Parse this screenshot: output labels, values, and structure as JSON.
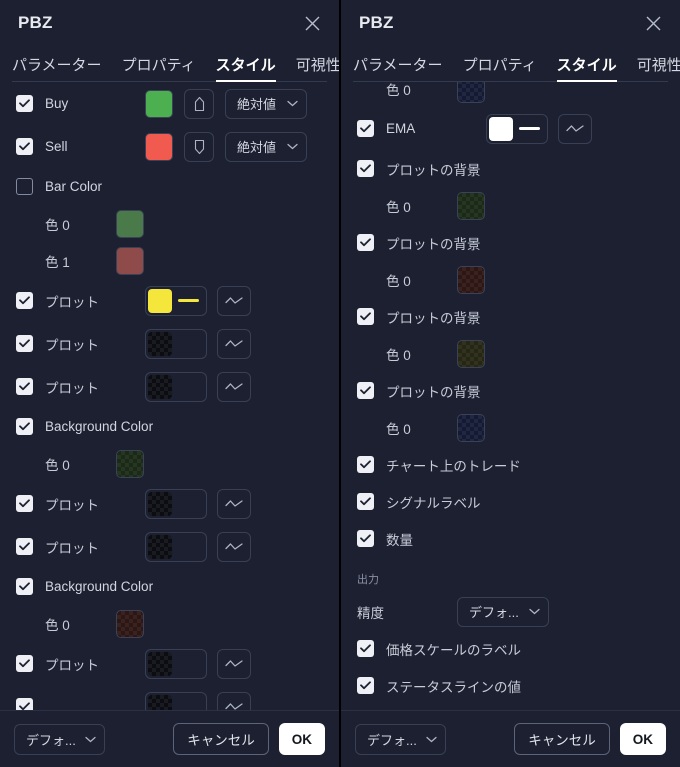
{
  "window": {
    "title": "PBZ",
    "close_icon": "close-icon"
  },
  "tabs": [
    {
      "label": "パラメーター",
      "active": false
    },
    {
      "label": "プロパティ",
      "active": false
    },
    {
      "label": "スタイル",
      "active": true
    },
    {
      "label": "可視性",
      "active": false
    }
  ],
  "footer": {
    "defaults_label": "デフォ...",
    "cancel_label": "キャンセル",
    "ok_label": "OK",
    "chevron_icon": "chevron-down-icon"
  },
  "colors": {
    "panel_bg": "#1c2030",
    "buy_green": "#4caf50",
    "sell_red": "#f05a4f",
    "bar_green": "#4a7a4a",
    "bar_red": "#8f4a4a",
    "plot_yellow": "#f5e63c",
    "ema_white": "#ffffff",
    "accent_underline": "#ffffff",
    "checker_neutral": "#0c0d12",
    "checker_green": "#1a2a16",
    "checker_red": "#2e1614",
    "checker_olive": "#262614",
    "checker_blue": "#141a33"
  },
  "left_panel": {
    "rows": [
      {
        "kind": "plot_marker",
        "checked": true,
        "label": "Buy",
        "swatch": "#4caf50",
        "marker_icon": "arrow-up-marker-icon",
        "select_value": "絶対値"
      },
      {
        "kind": "plot_marker",
        "checked": true,
        "label": "Sell",
        "swatch": "#f05a4f",
        "marker_icon": "arrow-down-marker-icon",
        "select_value": "絶対値"
      },
      {
        "kind": "header",
        "checked": false,
        "label": "Bar Color"
      },
      {
        "kind": "sub_color",
        "label": "色 0",
        "swatch": "#4a7a4a",
        "transparent": false
      },
      {
        "kind": "sub_color",
        "label": "色 1",
        "swatch": "#8f4a4a",
        "transparent": false
      },
      {
        "kind": "plot_line",
        "checked": true,
        "label": "プロット",
        "swatch": "#f5e63c",
        "line_color": "#f5e63c",
        "transparent": false,
        "style_icon": "line-style-icon"
      },
      {
        "kind": "plot_line",
        "checked": true,
        "label": "プロット",
        "swatch": "transparent",
        "line_color": "transparent",
        "transparent": true,
        "style_icon": "line-style-icon"
      },
      {
        "kind": "plot_line",
        "checked": true,
        "label": "プロット",
        "swatch": "transparent",
        "line_color": "transparent",
        "transparent": true,
        "style_icon": "line-style-icon"
      },
      {
        "kind": "header",
        "checked": true,
        "label": "Background Color"
      },
      {
        "kind": "sub_color",
        "label": "色 0",
        "swatch": "#1a2a16",
        "transparent": true
      },
      {
        "kind": "plot_line",
        "checked": true,
        "label": "プロット",
        "swatch": "transparent",
        "line_color": "transparent",
        "transparent": true,
        "style_icon": "line-style-icon"
      },
      {
        "kind": "plot_line",
        "checked": true,
        "label": "プロット",
        "swatch": "transparent",
        "line_color": "transparent",
        "transparent": true,
        "style_icon": "line-style-icon"
      },
      {
        "kind": "header",
        "checked": true,
        "label": "Background Color"
      },
      {
        "kind": "sub_color",
        "label": "色 0",
        "swatch": "#2e1614",
        "transparent": true
      },
      {
        "kind": "plot_line",
        "checked": true,
        "label": "プロット",
        "swatch": "transparent",
        "line_color": "transparent",
        "transparent": true,
        "style_icon": "line-style-icon"
      },
      {
        "kind": "plot_line_partial",
        "checked": true,
        "label": "",
        "swatch": "transparent",
        "transparent": true,
        "style_icon": "line-style-icon"
      }
    ]
  },
  "right_panel": {
    "rows": [
      {
        "kind": "sub_color_partial",
        "label": "色 0",
        "swatch": "#141a33",
        "transparent": true
      },
      {
        "kind": "plot_line",
        "checked": true,
        "label": "EMA",
        "swatch": "#ffffff",
        "line_color": "#ffffff",
        "transparent": false,
        "style_icon": "line-style-icon"
      },
      {
        "kind": "header",
        "checked": true,
        "label": "プロットの背景"
      },
      {
        "kind": "sub_color",
        "label": "色 0",
        "swatch": "#1a2a16",
        "transparent": true
      },
      {
        "kind": "header",
        "checked": true,
        "label": "プロットの背景"
      },
      {
        "kind": "sub_color",
        "label": "色 0",
        "swatch": "#2e1614",
        "transparent": true
      },
      {
        "kind": "header",
        "checked": true,
        "label": "プロットの背景"
      },
      {
        "kind": "sub_color",
        "label": "色 0",
        "swatch": "#262614",
        "transparent": true
      },
      {
        "kind": "header",
        "checked": true,
        "label": "プロットの背景"
      },
      {
        "kind": "sub_color",
        "label": "色 0",
        "swatch": "#141a33",
        "transparent": true
      },
      {
        "kind": "checkbox",
        "checked": true,
        "label": "チャート上のトレード"
      },
      {
        "kind": "checkbox",
        "checked": true,
        "label": "シグナルラベル"
      },
      {
        "kind": "checkbox",
        "checked": true,
        "label": "数量"
      },
      {
        "kind": "section",
        "label": "出力"
      },
      {
        "kind": "select",
        "label": "精度",
        "select_value": "デフォ..."
      },
      {
        "kind": "checkbox",
        "checked": true,
        "label": "価格スケールのラベル"
      },
      {
        "kind": "checkbox",
        "checked": true,
        "label": "ステータスラインの値"
      }
    ]
  }
}
